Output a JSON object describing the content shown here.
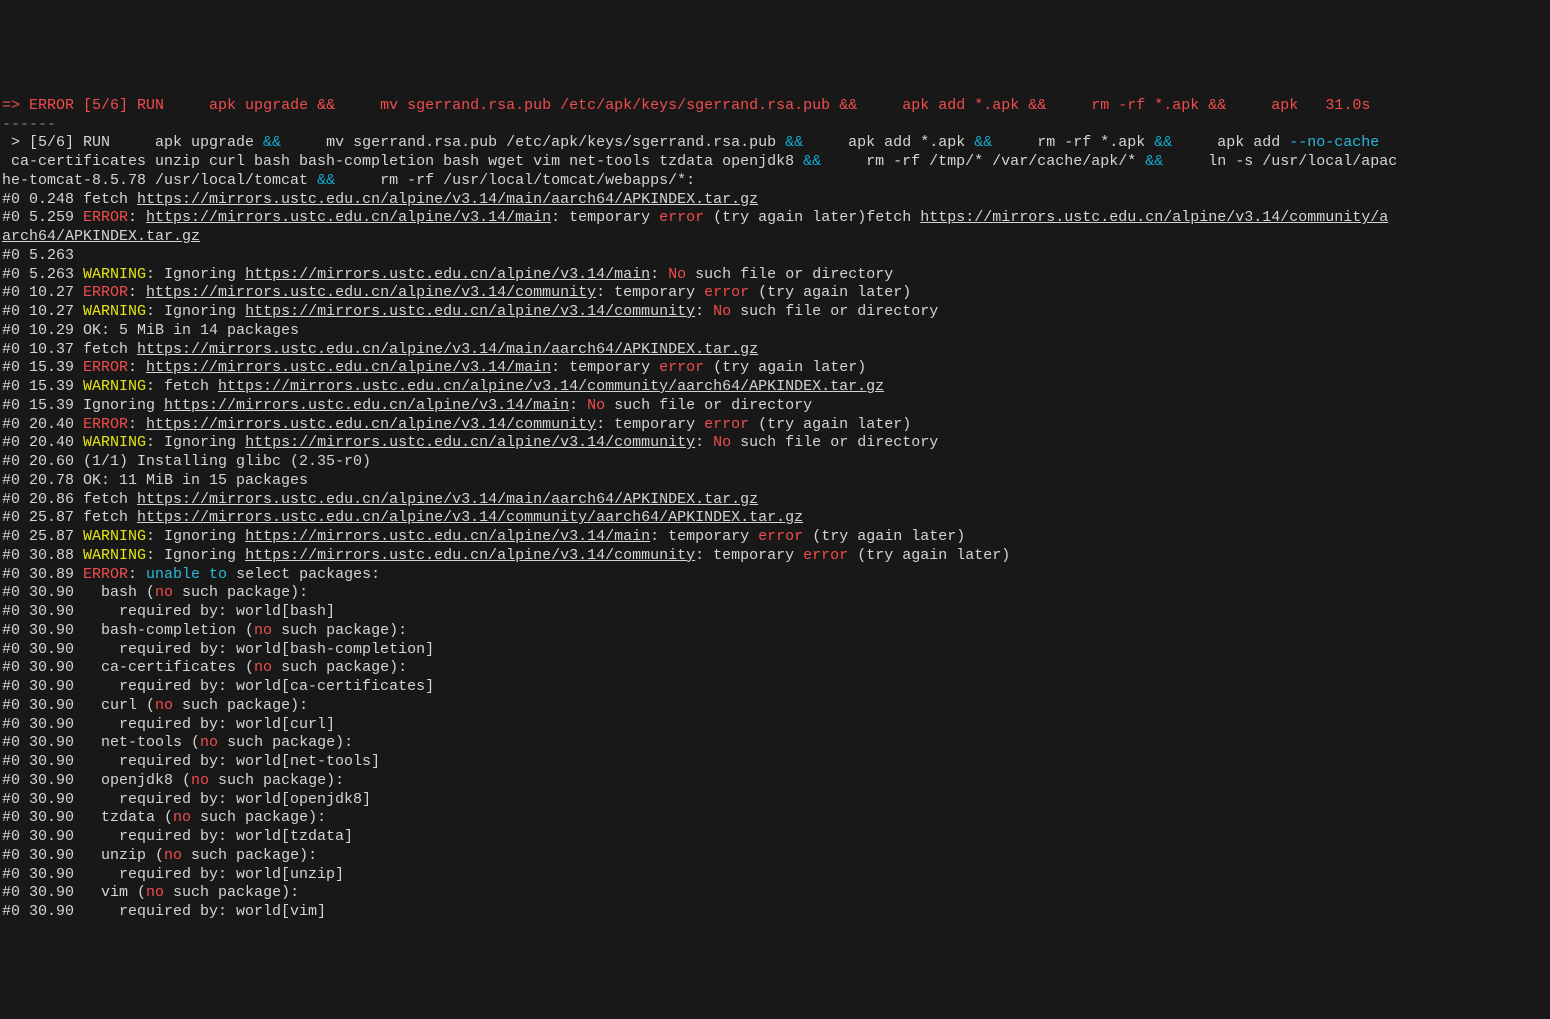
{
  "header": {
    "arrow": "=> ",
    "err": "ERROR",
    "step": " [5/6] RUN",
    "cmd_a": "     apk upgrade ",
    "amp1": "&&",
    "cmd_b": "     mv sgerrand.rsa.pub /etc/apk/keys/sgerrand.rsa.pub ",
    "amp2": "&&",
    "cmd_c": "     apk add *.apk ",
    "amp3": "&&",
    "cmd_d": "     rm -rf *.apk ",
    "amp4": "&&",
    "cmd_e": "     apk   ",
    "time": "31.0s"
  },
  "dashes": "------",
  "run1": {
    "a": " > [5/6] RUN     apk upgrade ",
    "amp1": "&&",
    "b": "     mv sgerrand.rsa.pub /etc/apk/keys/sgerrand.rsa.pub ",
    "amp2": "&&",
    "c": "     apk add *.apk ",
    "amp3": "&&",
    "d": "     rm -rf *.apk ",
    "amp4": "&&",
    "e": "     apk add ",
    "nocache": "--no-cache"
  },
  "run2": {
    "a": " ca-certificates unzip curl bash bash-completion bash wget vim net-tools tzdata openjdk8 ",
    "amp1": "&&",
    "b": "     rm -rf /tmp/* /var/cache/apk/* ",
    "amp2": "&&",
    "c": "     ln -s /usr/local/apac"
  },
  "run3": {
    "a": "he-tomcat-8.5.78 /usr/local/tomcat ",
    "amp1": "&&",
    "b": "     rm -rf /usr/local/tomcat/webapps/*:"
  },
  "l0248": {
    "pre": "#0 0.248 fetch ",
    "url": "https://mirrors.ustc.edu.cn/alpine/v3.14/main/aarch64/APKINDEX.tar.gz"
  },
  "l5259": {
    "pre": "#0 5.259 ",
    "err": "ERROR",
    "mid1": ": ",
    "url": "https://mirrors.ustc.edu.cn/alpine/v3.14/main",
    "mid2": ": temporary ",
    "err2": "error",
    "mid3": " (try again later)fetch ",
    "url2": "https://mirrors.ustc.edu.cn/alpine/v3.14/community/a"
  },
  "l5259b": {
    "url": "arch64/APKINDEX.tar.gz"
  },
  "l5263a": "#0 5.263",
  "l5263w": {
    "pre": "#0 5.263 ",
    "warn": "WARNING",
    "mid1": ": Ignoring ",
    "url": "https://mirrors.ustc.edu.cn/alpine/v3.14/main",
    "mid2": ": ",
    "no": "No",
    "mid3": " such file or directory"
  },
  "l1027e": {
    "pre": "#0 10.27 ",
    "err": "ERROR",
    "mid1": ": ",
    "url": "https://mirrors.ustc.edu.cn/alpine/v3.14/community",
    "mid2": ": temporary ",
    "err2": "error",
    "mid3": " (try again later)"
  },
  "l1027w": {
    "pre": "#0 10.27 ",
    "warn": "WARNING",
    "mid1": ": Ignoring ",
    "url": "https://mirrors.ustc.edu.cn/alpine/v3.14/community",
    "mid2": ": ",
    "no": "No",
    "mid3": " such file or directory"
  },
  "l1029": "#0 10.29 OK: 5 MiB in 14 packages",
  "l1037": {
    "pre": "#0 10.37 fetch ",
    "url": "https://mirrors.ustc.edu.cn/alpine/v3.14/main/aarch64/APKINDEX.tar.gz"
  },
  "l1539e": {
    "pre": "#0 15.39 ",
    "err": "ERROR",
    "mid1": ": ",
    "url": "https://mirrors.ustc.edu.cn/alpine/v3.14/main",
    "mid2": ": temporary ",
    "err2": "error",
    "mid3": " (try again later)"
  },
  "l1539w": {
    "pre": "#0 15.39 ",
    "warn": "WARNING",
    "mid1": ": fetch ",
    "url": "https://mirrors.ustc.edu.cn/alpine/v3.14/community/aarch64/APKINDEX.tar.gz"
  },
  "l1539i": {
    "pre": "#0 15.39 Ignoring ",
    "url": "https://mirrors.ustc.edu.cn/alpine/v3.14/main",
    "mid2": ": ",
    "no": "No",
    "mid3": " such file or directory"
  },
  "l2040e": {
    "pre": "#0 20.40 ",
    "err": "ERROR",
    "mid1": ": ",
    "url": "https://mirrors.ustc.edu.cn/alpine/v3.14/community",
    "mid2": ": temporary ",
    "err2": "error",
    "mid3": " (try again later)"
  },
  "l2040w": {
    "pre": "#0 20.40 ",
    "warn": "WARNING",
    "mid1": ": Ignoring ",
    "url": "https://mirrors.ustc.edu.cn/alpine/v3.14/community",
    "mid2": ": ",
    "no": "No",
    "mid3": " such file or directory"
  },
  "l2060": "#0 20.60 (1/1) Installing glibc (2.35-r0)",
  "l2078": "#0 20.78 OK: 11 MiB in 15 packages",
  "l2086": {
    "pre": "#0 20.86 fetch ",
    "url": "https://mirrors.ustc.edu.cn/alpine/v3.14/main/aarch64/APKINDEX.tar.gz"
  },
  "l2587": {
    "pre": "#0 25.87 fetch ",
    "url": "https://mirrors.ustc.edu.cn/alpine/v3.14/community/aarch64/APKINDEX.tar.gz"
  },
  "l2587w": {
    "pre": "#0 25.87 ",
    "warn": "WARNING",
    "mid1": ": Ignoring ",
    "url": "https://mirrors.ustc.edu.cn/alpine/v3.14/main",
    "mid2": ": temporary ",
    "err2": "error",
    "mid3": " (try again later)"
  },
  "l3088": {
    "pre": "#0 30.88 ",
    "warn": "WARNING",
    "mid1": ": Ignoring ",
    "url": "https://mirrors.ustc.edu.cn/alpine/v3.14/community",
    "mid2": ": temporary ",
    "err2": "error",
    "mid3": " (try again later)"
  },
  "l3089": {
    "pre": "#0 30.89 ",
    "err": "ERROR",
    "mid1": ": ",
    "unable": "unable to",
    "mid2": " select packages:"
  },
  "pkg": {
    "bash": {
      "a": "#0 30.90   bash (",
      "no": "no",
      "b": " such package):",
      "r": "#0 30.90     required by: world[bash]"
    },
    "bash_completion": {
      "a": "#0 30.90   bash-completion (",
      "no": "no",
      "b": " such package):",
      "r": "#0 30.90     required by: world[bash-completion]"
    },
    "ca": {
      "a": "#0 30.90   ca-certificates (",
      "no": "no",
      "b": " such package):",
      "r": "#0 30.90     required by: world[ca-certificates]"
    },
    "curl": {
      "a": "#0 30.90   curl (",
      "no": "no",
      "b": " such package):",
      "r": "#0 30.90     required by: world[curl]"
    },
    "net": {
      "a": "#0 30.90   net-tools (",
      "no": "no",
      "b": " such package):",
      "r": "#0 30.90     required by: world[net-tools]"
    },
    "jdk": {
      "a": "#0 30.90   openjdk8 (",
      "no": "no",
      "b": " such package):",
      "r": "#0 30.90     required by: world[openjdk8]"
    },
    "tz": {
      "a": "#0 30.90   tzdata (",
      "no": "no",
      "b": " such package):",
      "r": "#0 30.90     required by: world[tzdata]"
    },
    "unzip": {
      "a": "#0 30.90   unzip (",
      "no": "no",
      "b": " such package):",
      "r": "#0 30.90     required by: world[unzip]"
    },
    "vim": {
      "a": "#0 30.90   vim (",
      "no": "no",
      "b": " such package):",
      "r": "#0 30.90     required by: world[vim]"
    }
  }
}
